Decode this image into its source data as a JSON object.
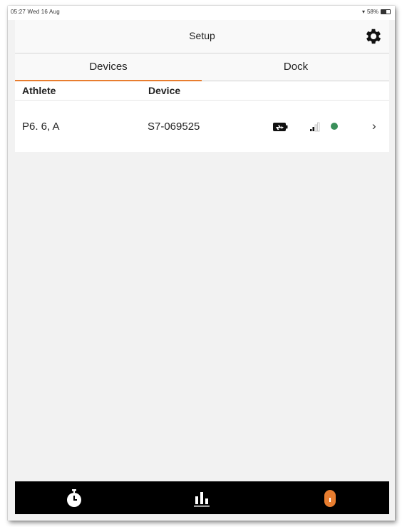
{
  "status_bar": {
    "time_date": "05:27  Wed 16 Aug",
    "battery": "58%"
  },
  "navbar": {
    "title": "Setup"
  },
  "tabs": [
    {
      "label": "Devices"
    },
    {
      "label": "Dock"
    }
  ],
  "columns": {
    "athlete": "Athlete",
    "device": "Device"
  },
  "rows": [
    {
      "athlete": "P6. 6, A",
      "device": "S7-069525",
      "status_color": "#3a8f5a",
      "chevron": "›"
    }
  ],
  "accent_color": "#e87d2f",
  "icons": {
    "settings": "gear-icon",
    "battery": "battery-charging-icon",
    "signal": "signal-icon",
    "tabbar": [
      "stopwatch-icon",
      "bar-chart-icon",
      "device-icon"
    ]
  }
}
